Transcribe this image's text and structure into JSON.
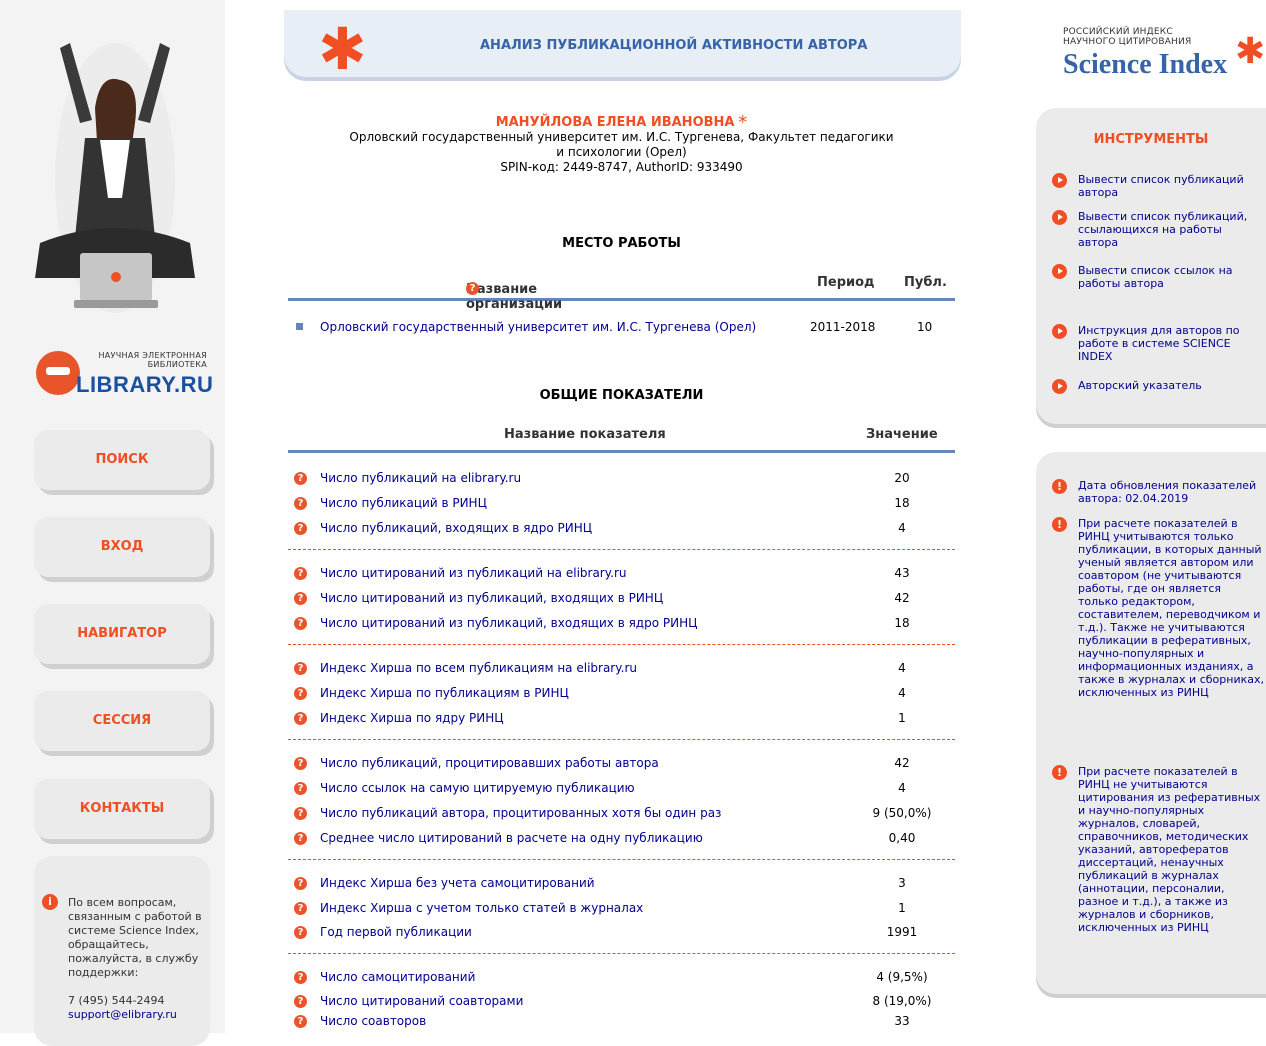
{
  "page_title": "АНАЛИЗ ПУБЛИКАЦИОННОЙ АКТИВНОСТИ АВТОРА",
  "author": {
    "name": "МАНУЙЛОВА ЕЛЕНА ИВАНОВНА",
    "affiliation": "Орловский государственный университет им. И.С. Тургенева, Факультет педагогики и психологии (Орел)",
    "ids": "SPIN-код: 2449-8747, AuthorID: 933490"
  },
  "elibrary_logo": {
    "small": "НАУЧНАЯ ЭЛЕКТРОННАЯ БИБЛИОТЕКА",
    "word": "LIBRARY.RU"
  },
  "nav": [
    "ПОИСК",
    "ВХОД",
    "НАВИГАТОР",
    "СЕССИЯ",
    "КОНТАКТЫ"
  ],
  "support": {
    "text": "По всем вопросам, связанным с работой в системе Science Index, обращайтесь, пожалуйста, в службу поддержки:",
    "phone": "7 (495) 544-2494",
    "email": "support@elibrary.ru"
  },
  "workplace": {
    "title": "МЕСТО РАБОТЫ",
    "col_org": "Название организации",
    "col_period": "Период",
    "col_pub": "Публ.",
    "rows": [
      {
        "org": "Орловский государственный университет им. И.С. Тургенева (Орел)",
        "period": "2011-2018",
        "pub": "10"
      }
    ]
  },
  "indicators": {
    "title": "ОБЩИЕ ПОКАЗАТЕЛИ",
    "col_name": "Название показателя",
    "col_value": "Значение",
    "rows": [
      {
        "label": "Число публикаций на elibrary.ru",
        "value": "20"
      },
      {
        "label": "Число публикаций в РИНЦ",
        "value": "18"
      },
      {
        "label": "Число публикаций, входящих в ядро РИНЦ",
        "value": "4"
      },
      {
        "label": "Число цитирований из публикаций на elibrary.ru",
        "value": "43"
      },
      {
        "label": "Число цитирований из публикаций, входящих в РИНЦ",
        "value": "42"
      },
      {
        "label": "Число цитирований из публикаций, входящих в ядро РИНЦ",
        "value": "18"
      },
      {
        "label": "Индекс Хирша по всем публикациям на elibrary.ru",
        "value": "4"
      },
      {
        "label": "Индекс Хирша по публикациям в РИНЦ",
        "value": "4"
      },
      {
        "label": "Индекс Хирша по ядру РИНЦ",
        "value": "1"
      },
      {
        "label": "Число публикаций, процитировавших работы автора",
        "value": "42"
      },
      {
        "label": "Число ссылок на самую цитируемую публикацию",
        "value": "4"
      },
      {
        "label": "Число публикаций автора, процитированных хотя бы один раз",
        "value": "9 (50,0%)"
      },
      {
        "label": "Среднее число цитирований в расчете на одну публикацию",
        "value": "0,40"
      },
      {
        "label": "Индекс Хирша без учета самоцитирований",
        "value": "3"
      },
      {
        "label": "Индекс Хирша с учетом только статей в журналах",
        "value": "1"
      },
      {
        "label": "Год первой публикации",
        "value": "1991"
      },
      {
        "label": "Число самоцитирований",
        "value": "4 (9,5%)"
      },
      {
        "label": "Число цитирований соавторами",
        "value": "8 (19,0%)"
      },
      {
        "label": "Число соавторов",
        "value": "33"
      }
    ]
  },
  "science_index": {
    "line1": "РОССИЙСКИЙ ИНДЕКС",
    "line2": "НАУЧНОГО ЦИТИРОВАНИЯ",
    "word": "Science Index"
  },
  "tools": {
    "title": "ИНСТРУМЕНТЫ",
    "items": [
      "Вывести список публикаций автора",
      "Вывести список публикаций, ссылающихся на работы автора",
      "Вывести список ссылок на работы автора",
      "Инструкция для авторов по работе в системе SCIENCE INDEX",
      "Авторский указатель"
    ]
  },
  "notes": [
    "Дата обновления показателей автора: 02.04.2019",
    "При расчете показателей в РИНЦ учитываются только публикации, в которых данный ученый является автором или соавтором (не учитываются работы, где он является только редактором, составителем, переводчиком и т.д.). Также не учитываются публикации в реферативных, научно-популярных и информационных изданиях, а также в журналах и сборниках, исключенных из РИНЦ",
    "При расчете показателей в РИНЦ не учитываются цитирования из реферативных и научно-популярных журналов, словарей, справочников, методических указаний, авторефератов диссертаций, ненаучных публикаций в журналах (аннотации, персоналии, разное и т.д.), а также из журналов и сборников, исключенных из РИНЦ"
  ],
  "colors": {
    "accent": "#f04e23",
    "link": "#00008f",
    "rule": "#6585bf",
    "title_blue": "#3763a8"
  }
}
